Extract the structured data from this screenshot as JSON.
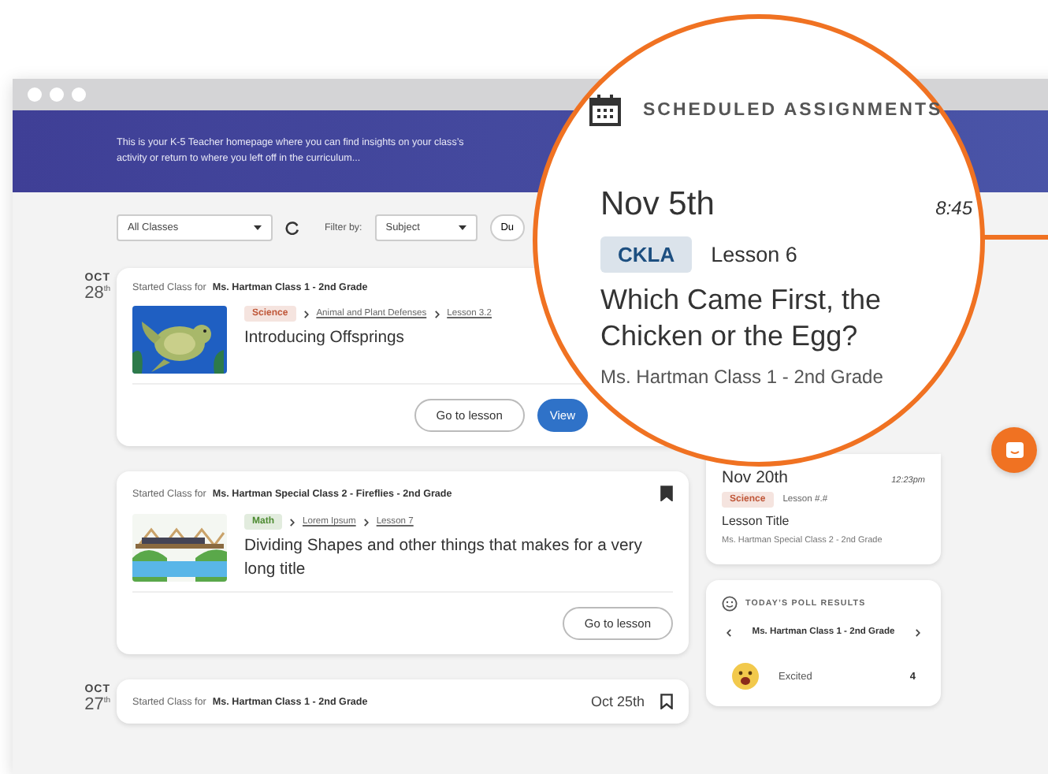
{
  "banner": {
    "text": "This is your K-5 Teacher homepage where you can find insights on your class’s activity or return to where you left off in the curriculum..."
  },
  "filters": {
    "class_select": "All Classes",
    "filter_label": "Filter by:",
    "subject_select": "Subject",
    "due_button": "Du"
  },
  "activity": [
    {
      "month": "OCT",
      "day": "28$^{th}$",
      "cards": [
        {
          "intro": "Started Class for",
          "class_name": "Ms. Hartman Class 1 - 2nd Grade",
          "subject": {
            "label": "Science",
            "color": "#c0583a"
          },
          "breadcrumbs": [
            "Animal and Plant Defenses",
            "Lesson 3.2"
          ],
          "title": "Introducing Offsprings",
          "buttons": [
            {
              "label": "Go to lesson",
              "kind": "outline"
            },
            {
              "label": "View",
              "kind": "primary"
            }
          ]
        },
        {
          "intro": "Started Class for",
          "class_name": "Ms. Hartman Special Class 2 - Fireflies - 2nd Grade",
          "bookmarked": true,
          "subject": {
            "label": "Math",
            "color": "#4b8a2f"
          },
          "breadcrumbs": [
            "Lorem Ipsum",
            "Lesson 7"
          ],
          "title": "Dividing Shapes and other things that makes for a very long title",
          "buttons": [
            {
              "label": "Go to lesson",
              "kind": "outline"
            }
          ]
        }
      ]
    },
    {
      "month": "OCT",
      "day": "27$^{th}$",
      "cards": [
        {
          "intro": "Started Class for",
          "class_name": "Ms. Hartman Class 1 - 2nd Grade",
          "date": "Oct 25th",
          "bookmarked": false
        }
      ]
    }
  ],
  "scheduled": {
    "items": [
      {
        "date": "Nov 20th",
        "time": "12:23pm",
        "subject": {
          "label": "Science",
          "color": "#c0583a"
        },
        "lesson": "Lesson #.#",
        "title": "Lesson Title",
        "class_name": "Ms. Hartman Special Class 2 - 2nd Grade"
      }
    ]
  },
  "poll": {
    "title": "TODAY’S POLL RESULTS",
    "class_name": "Ms. Hartman Class 1 - 2nd Grade",
    "results": [
      {
        "label": "Excited",
        "count": "4"
      }
    ]
  },
  "magnifier": {
    "title": "SCHEDULED ASSIGNMENTS",
    "date": "Nov 5th",
    "time": "8:45",
    "subject": {
      "label": "CKLA",
      "color": "#1d4f80"
    },
    "lesson": "Lesson 6",
    "assignment": "Which Came First, the Chicken or the Egg?",
    "class_name": "Ms. Hartman Class 1 - 2nd Grade"
  }
}
